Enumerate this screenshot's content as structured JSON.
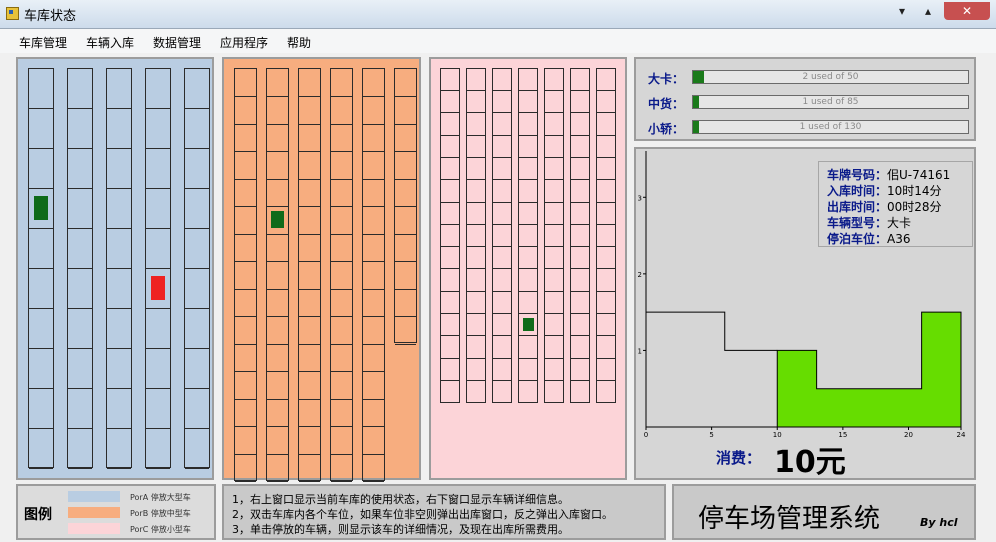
{
  "window": {
    "title": "车库状态",
    "min_glyph": "▾",
    "max_glyph": "▴",
    "close_glyph": "✕"
  },
  "menu": [
    "车库管理",
    "车辆入库",
    "数据管理",
    "应用程序",
    "帮助"
  ],
  "lots": {
    "A": {
      "color": "#b9cde2",
      "columns": 5,
      "rows": 10,
      "cars": [
        {
          "col": 0,
          "row": 3,
          "color": "#0f6b1a"
        },
        {
          "col": 3,
          "row": 5,
          "color": "#ee2222"
        }
      ]
    },
    "B": {
      "color": "#f7ad7f",
      "columns": 6,
      "rows": 15,
      "cars": [
        {
          "col": 1,
          "row": 5,
          "color": "#0f6b1a"
        }
      ]
    },
    "C": {
      "color": "#fcd4d8",
      "columns": 7,
      "rows": 15,
      "cars": [
        {
          "col": 3,
          "row": 11,
          "color": "#0f6b1a"
        }
      ]
    }
  },
  "capacity": [
    {
      "label": "大卡：",
      "text": "2 used of 50",
      "used": 2,
      "total": 50
    },
    {
      "label": "中货：",
      "text": "1 used of 85",
      "used": 1,
      "total": 85
    },
    {
      "label": "小轿：",
      "text": "1 used of 130",
      "used": 1,
      "total": 130
    }
  ],
  "vehicle_info": [
    {
      "key": "车牌号码：",
      "value": "佀U-74161"
    },
    {
      "key": "入库时间：",
      "value": "10时14分"
    },
    {
      "key": "出库时间：",
      "value": "00时28分"
    },
    {
      "key": "车辆型号：",
      "value": "大卡"
    },
    {
      "key": "停泊车位：",
      "value": "A36"
    }
  ],
  "fee": {
    "label": "消费：",
    "value": "10元"
  },
  "chart_data": {
    "type": "area",
    "x_ticks": [
      "0",
      "5",
      "10",
      "15",
      "20",
      "24"
    ],
    "y_ticks": [
      "1",
      "2",
      "3"
    ],
    "xlim": [
      0,
      24
    ],
    "ylim": [
      0,
      3.5
    ],
    "rate_line": [
      [
        0,
        1.5
      ],
      [
        6,
        1.5
      ],
      [
        6,
        1.0
      ],
      [
        10,
        1.0
      ]
    ],
    "charged_area": [
      [
        10,
        1.0
      ],
      [
        13,
        1.0
      ],
      [
        13,
        0.5
      ],
      [
        21,
        0.5
      ],
      [
        21,
        1.5
      ],
      [
        24,
        1.5
      ]
    ],
    "fill_color": "#66dd00"
  },
  "legend": {
    "title": "图例",
    "items": [
      {
        "color": "#b9cde2",
        "text": "PorA 停放大型车"
      },
      {
        "color": "#f7ad7f",
        "text": "PorB 停放中型车"
      },
      {
        "color": "#fcd4d8",
        "text": "PorC 停放小型车"
      }
    ]
  },
  "notes": [
    "1，右上窗口显示当前车库的使用状态，右下窗口显示车辆详细信息。",
    "2，双击车库内各个车位，如果车位非空则弹出出库窗口，反之弹出入库窗口。",
    "3，单击停放的车辆，则显示该车的详细情况，及现在出库所需费用。"
  ],
  "brand": {
    "title": "停车场管理系统",
    "by": "By hcl"
  }
}
